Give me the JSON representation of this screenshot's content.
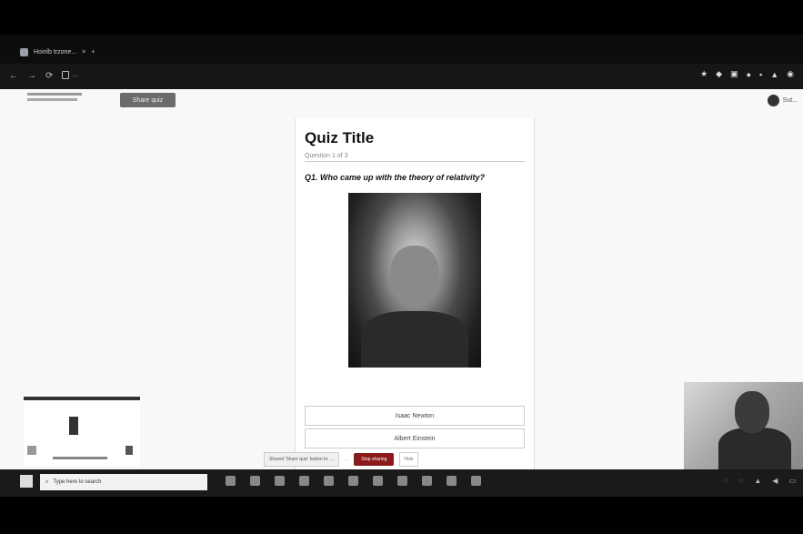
{
  "browser": {
    "tab_title": "Hoinlb trzone...",
    "url": "..."
  },
  "page": {
    "share_label": "Share quiz",
    "user_label": "Sut..."
  },
  "quiz": {
    "title": "Quiz Title",
    "subtitle": "Question 1 of 3",
    "question": "Q1. Who came up with the theory of relativity?",
    "answers": [
      "Isaac Newton",
      "Albert Einstein"
    ]
  },
  "overlay": {
    "share_text": "Shared 'Share quiz' button to: ...",
    "link_text": "...",
    "stop_button": "Stop sharing",
    "hide_button": "Hide"
  },
  "taskbar": {
    "search_placeholder": "Type here to search"
  }
}
